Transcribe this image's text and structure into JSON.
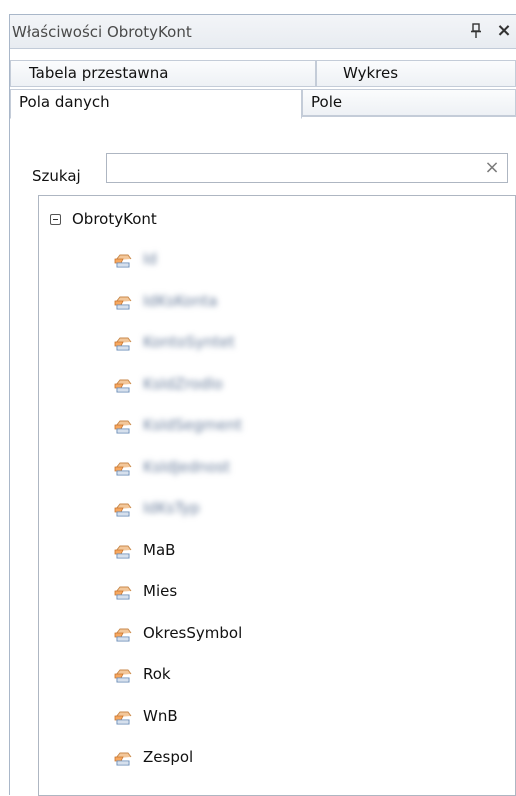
{
  "window": {
    "title": "Właściwości ObrotyKont",
    "pin_glyph": "🖈",
    "close_glyph": "×"
  },
  "tabs": {
    "row1": [
      {
        "label": "Tabela przestawna"
      },
      {
        "label": "Wykres"
      }
    ],
    "row2": [
      {
        "label": "Pola danych",
        "active": true
      },
      {
        "label": "Pole"
      }
    ]
  },
  "search": {
    "label": "Szukaj",
    "value": "",
    "placeholder": "",
    "clear_glyph": "×"
  },
  "tree": {
    "root_label": "ObrotyKont",
    "root_expanded": true,
    "items": [
      {
        "label": "Id",
        "blurred": true
      },
      {
        "label": "IdKsKonta",
        "blurred": true
      },
      {
        "label": "KontoSyntet",
        "blurred": true
      },
      {
        "label": "KsIdZrodlo",
        "blurred": true
      },
      {
        "label": "KsIdSegment",
        "blurred": true
      },
      {
        "label": "KsIdJednost",
        "blurred": true
      },
      {
        "label": "IdKsTyp",
        "blurred": true
      },
      {
        "label": "MaB",
        "blurred": false
      },
      {
        "label": "Mies",
        "blurred": false
      },
      {
        "label": "OkresSymbol",
        "blurred": false
      },
      {
        "label": "Rok",
        "blurred": false
      },
      {
        "label": "WnB",
        "blurred": false
      },
      {
        "label": "Zespol",
        "blurred": false
      }
    ]
  },
  "icons": {
    "field": "field-icon",
    "expander": "collapse-icon"
  }
}
